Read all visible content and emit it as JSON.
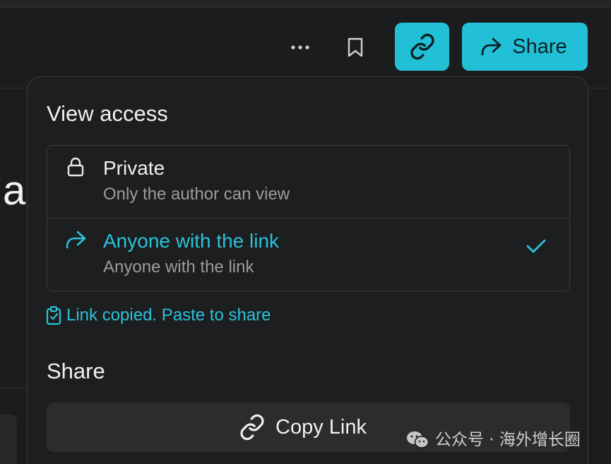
{
  "toolbar": {
    "more_icon": "more-horizontal-icon",
    "bookmark_icon": "bookmark-icon",
    "link_icon": "link-icon",
    "share_icon": "share-forward-icon",
    "share_label": "Share",
    "accent_color": "#22c0d7"
  },
  "background": {
    "partial_text": "a"
  },
  "popover": {
    "view_access_title": "View access",
    "options": [
      {
        "icon": "lock-icon",
        "label": "Private",
        "description": "Only the author can view",
        "selected": false
      },
      {
        "icon": "share-forward-icon",
        "label": "Anyone with the link",
        "description": "Anyone with the link",
        "selected": true
      }
    ],
    "status_message": "Link copied. Paste to share",
    "status_icon": "clipboard-check-icon",
    "share_title": "Share",
    "copy_link_label": "Copy Link",
    "copy_link_icon": "link-icon"
  },
  "watermark": {
    "text": "公众号 · 海外增长圈",
    "icon": "wechat-icon"
  }
}
